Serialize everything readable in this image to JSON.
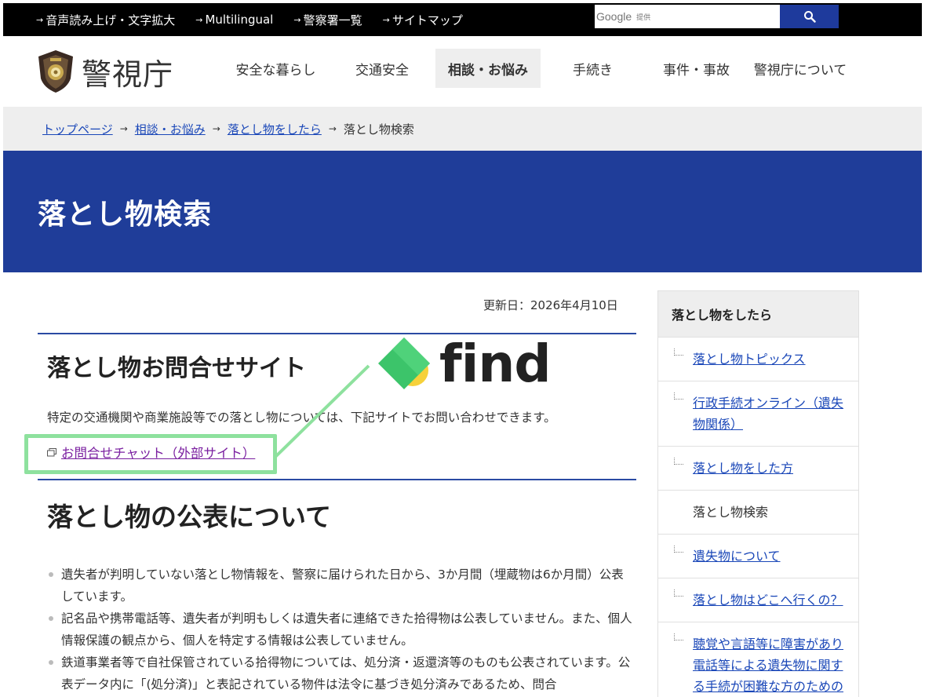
{
  "util_links": [
    "音声読み上げ・文字拡大",
    "Multilingual",
    "警察署一覧",
    "サイトマップ"
  ],
  "search": {
    "brand": "Google",
    "provided_by": "提供",
    "placeholder": ""
  },
  "logo_text": "警視庁",
  "nav": [
    {
      "label": "安全な暮らし",
      "active": false
    },
    {
      "label": "交通安全",
      "active": false
    },
    {
      "label": "相談・お悩み",
      "active": true
    },
    {
      "label": "手続き",
      "active": false
    },
    {
      "label": "事件・事故",
      "active": false
    },
    {
      "label": "警視庁について",
      "active": false
    }
  ],
  "breadcrumb": {
    "links": [
      "トップページ",
      "相談・お悩み",
      "落とし物をしたら"
    ],
    "current": "落とし物検索"
  },
  "page_title": "落とし物検索",
  "updated": "更新日：2026年4月10日",
  "section1": {
    "title": "落とし物お問合せサイト",
    "text": "特定の交通機関や商業施設等での落とし物については、下記サイトでお問い合わせできます。",
    "link": "お問合せチャット（外部サイト）",
    "find_brand": "find"
  },
  "section2": {
    "title": "落とし物の公表について",
    "bullets": [
      "遺失者が判明していない落とし物情報を、警察に届けられた日から、3か月間（埋蔵物は6か月間）公表しています。",
      "記名品や携帯電話等、遺失者が判明もしくは遺失者に連絡できた拾得物は公表していません。また、個人情報保護の観点から、個人を特定する情報は公表していません。",
      "鉄道事業者等で自社保管されている拾得物については、処分済・返還済等のものも公表されています。公表データ内に「(処分済)」と表記されている物件は法令に基づき処分済みであるため、問合"
    ]
  },
  "sidebar": {
    "heading": "落とし物をしたら",
    "items": [
      {
        "label": "落とし物トピックス",
        "link": true
      },
      {
        "label": "行政手続オンライン（遺失物関係）",
        "link": true
      },
      {
        "label": "落とし物をした方",
        "link": true
      },
      {
        "label": "落とし物検索",
        "link": false
      },
      {
        "label": "遺失物について",
        "link": true
      },
      {
        "label": "落とし物はどこへ行くの？",
        "link": true
      },
      {
        "label": "聴覚や言語等に障害があり電話等による遺失物に関する手続が困難な方のための窓口（遺失物BOX）",
        "link": true
      }
    ]
  },
  "colors": {
    "brand_blue": "#1f3d99",
    "link": "#1a47b8",
    "highlight": "#8ee19e",
    "find_green": "#3cc46a",
    "find_yellow": "#f6d13b"
  }
}
